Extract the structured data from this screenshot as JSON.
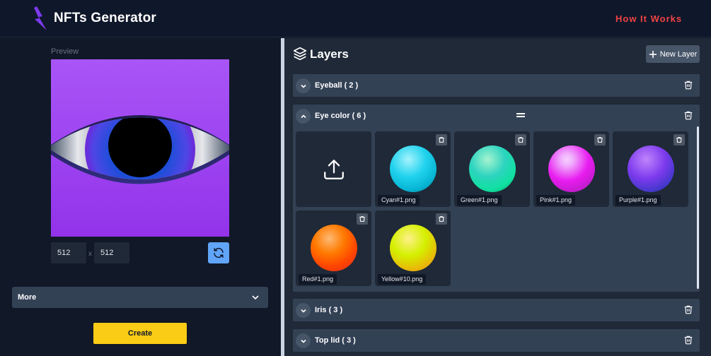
{
  "header": {
    "title": "NFTs Generator",
    "nav_link": "How It Works",
    "logo_icon": "lightning-bolt-icon",
    "accent_color": "#ef4444"
  },
  "preview": {
    "label": "Preview",
    "width_value": "512",
    "separator": "x",
    "height_value": "512",
    "more_label": "More",
    "create_label": "Create"
  },
  "layers_panel": {
    "title": "Layers",
    "new_layer_label": "New Layer",
    "layers": [
      {
        "name": "Eyeball ( 2 )",
        "expanded": false
      },
      {
        "name": "Eye color ( 6 )",
        "expanded": true
      },
      {
        "name": "Iris ( 3 )",
        "expanded": false
      },
      {
        "name": "Top lid ( 3 )",
        "expanded": false
      }
    ],
    "eye_color_items": [
      {
        "label": "Cyan#1.png",
        "color": "#22d3ee"
      },
      {
        "label": "Green#1.png",
        "color": "#10e0a0"
      },
      {
        "label": "Pink#1.png",
        "color": "#e81cf0"
      },
      {
        "label": "Purple#1.png",
        "color": "#7c3aed"
      },
      {
        "label": "Red#1.png",
        "color": "#ff4500"
      },
      {
        "label": "Yellow#10.png",
        "color": "#d4f000"
      }
    ]
  }
}
